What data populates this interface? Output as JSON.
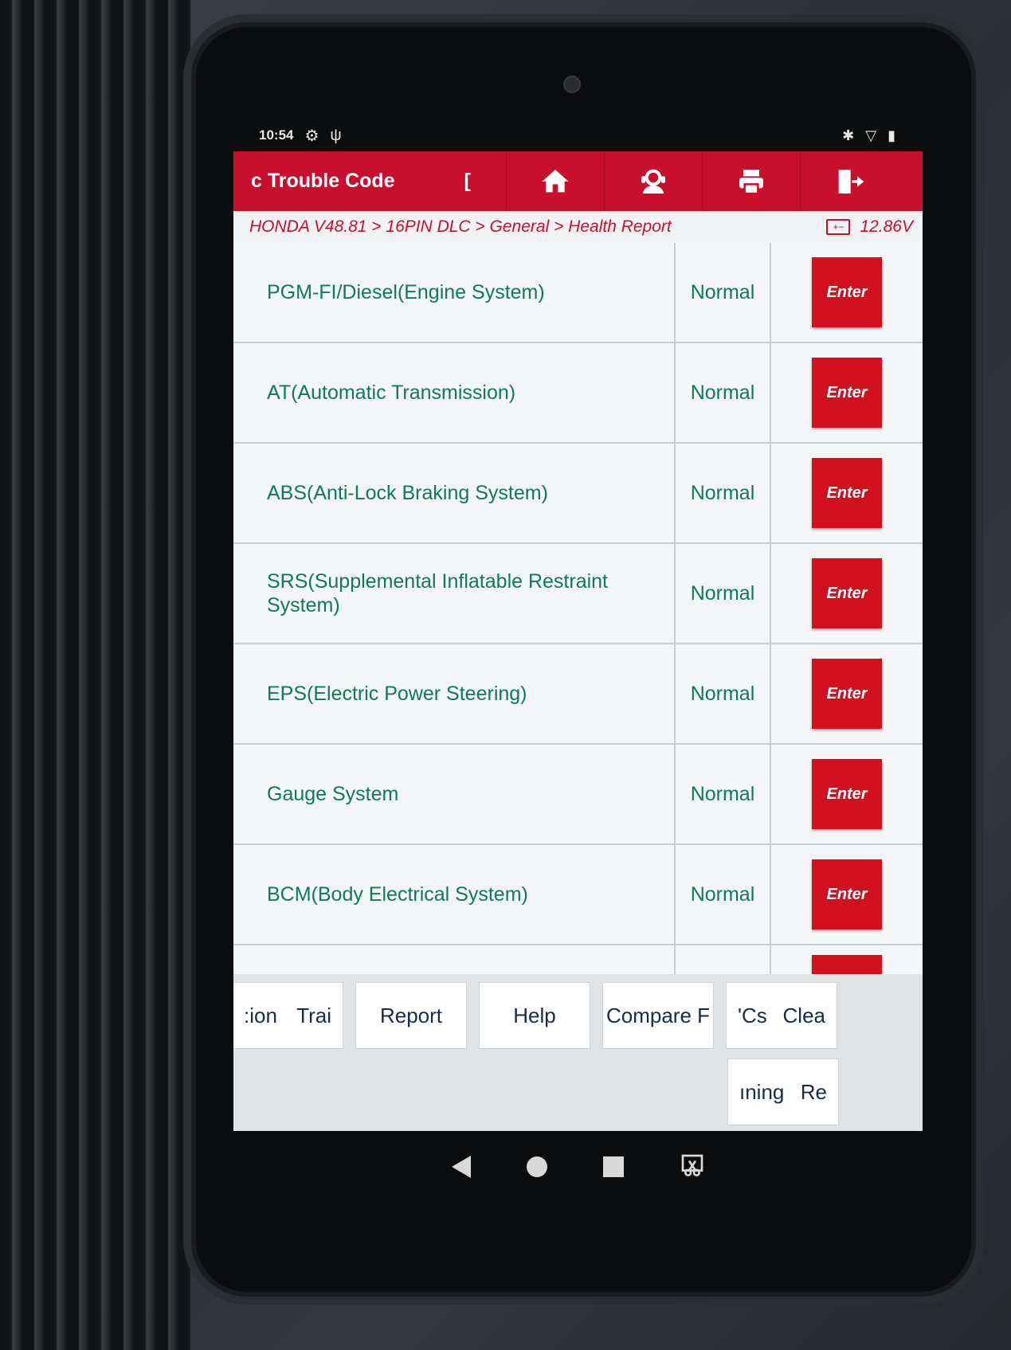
{
  "status_bar": {
    "time": "10:54",
    "icons_left": [
      "settings-gear-icon",
      "usb-debug-icon"
    ],
    "icons_right": [
      "bluetooth-icon",
      "wifi-icon",
      "battery-icon"
    ]
  },
  "appbar": {
    "title": "c Trouble Code",
    "title_tail": "[",
    "buttons": [
      "home-icon",
      "support-icon",
      "print-icon",
      "exit-icon"
    ]
  },
  "breadcrumb": {
    "path": "HONDA V48.81 > 16PIN DLC > General > Health Report",
    "voltage": "12.86V"
  },
  "systems": [
    {
      "name": "PGM-FI/Diesel(Engine System)",
      "status": "Normal",
      "action": "Enter"
    },
    {
      "name": "AT(Automatic Transmission)",
      "status": "Normal",
      "action": "Enter"
    },
    {
      "name": "ABS(Anti-Lock Braking System)",
      "status": "Normal",
      "action": "Enter"
    },
    {
      "name": "SRS(Supplemental Inflatable Restraint System)",
      "status": "Normal",
      "action": "Enter"
    },
    {
      "name": "EPS(Electric Power Steering)",
      "status": "Normal",
      "action": "Enter"
    },
    {
      "name": "Gauge System",
      "status": "Normal",
      "action": "Enter"
    },
    {
      "name": "BCM(Body Electrical System)",
      "status": "Normal",
      "action": "Enter"
    }
  ],
  "toolbar": {
    "btn1_left": ":ion",
    "btn1_right": "Trai",
    "report": "Report",
    "help": "Help",
    "compare": "Compare F",
    "btn5_left": "'Cs",
    "btn5_right": "Clea",
    "btn6_left": "ıning",
    "btn6_right": "Re"
  },
  "colors": {
    "accent_red": "#c8102e",
    "status_green": "#0f7a58"
  }
}
